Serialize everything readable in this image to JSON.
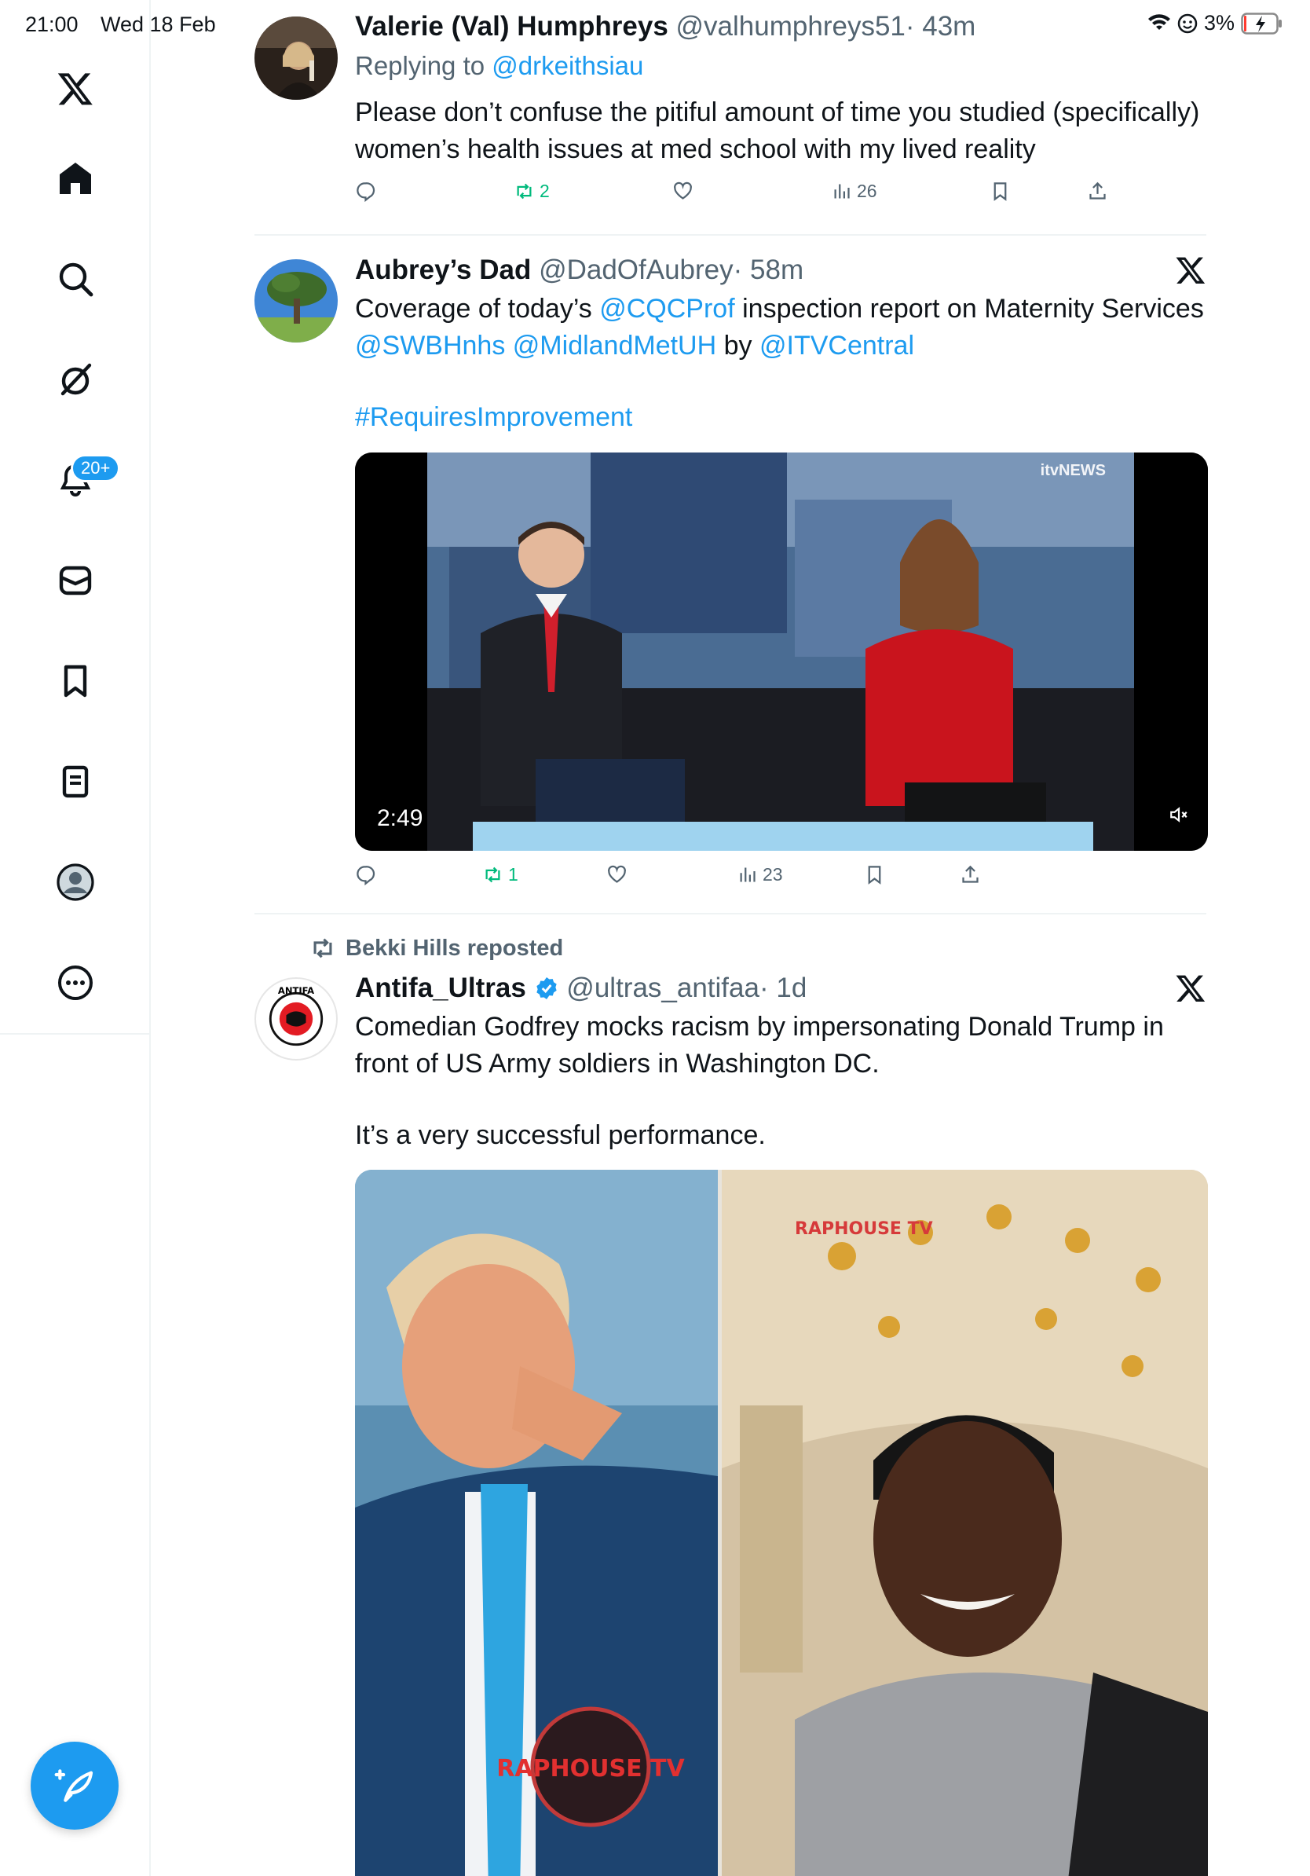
{
  "status_bar": {
    "time": "21:00",
    "date": "Wed 18 Feb",
    "battery": "3%"
  },
  "sidebar": {
    "notifications_badge": "20+"
  },
  "tweets": [
    {
      "name": "Valerie (Val) Humphreys",
      "handle": "@valhumphreys51",
      "time": "· 43m",
      "reply_prefix": "Replying to",
      "reply_to": "@drkeithsiau",
      "text": "Please don’t confuse the pitiful amount of time you studied (specifically) women’s health issues at med school with my lived reality",
      "reposts": "2",
      "views": "26"
    },
    {
      "name": "Aubrey’s Dad",
      "handle": "@DadOfAubrey",
      "time": "· 58m",
      "text_parts": {
        "p1": "Coverage of today’s ",
        "m1": "@CQCProf",
        "p2": " inspection report on Maternity Services ",
        "m2": "@SWBHnhs",
        "p3": " ",
        "m3": "@MidlandMetUH",
        "p4": " by ",
        "m4": "@ITVCentral",
        "hashtag": "#RequiresImprovement"
      },
      "video_duration": "2:49",
      "video_watermark": "itvNEWS",
      "reposts": "1",
      "views": "23"
    },
    {
      "reposted_by": "Bekki Hills reposted",
      "name": "Antifa_Ultras",
      "handle": "@ultras_antifaa",
      "time": "· 1d",
      "text": "Comedian Godfrey mocks racism by impersonating Donald Trump in front of US Army soldiers in Washington DC.",
      "text2": "It’s a very successful performance.",
      "image_watermark_1": "RAPHOUSE TV",
      "image_watermark_2": "RAPHOUSE TV"
    }
  ],
  "colors": {
    "accent": "#1d9bf0",
    "retweet_green": "#00ba7c",
    "secondary_text": "#536471",
    "divider": "#eff3f4"
  }
}
